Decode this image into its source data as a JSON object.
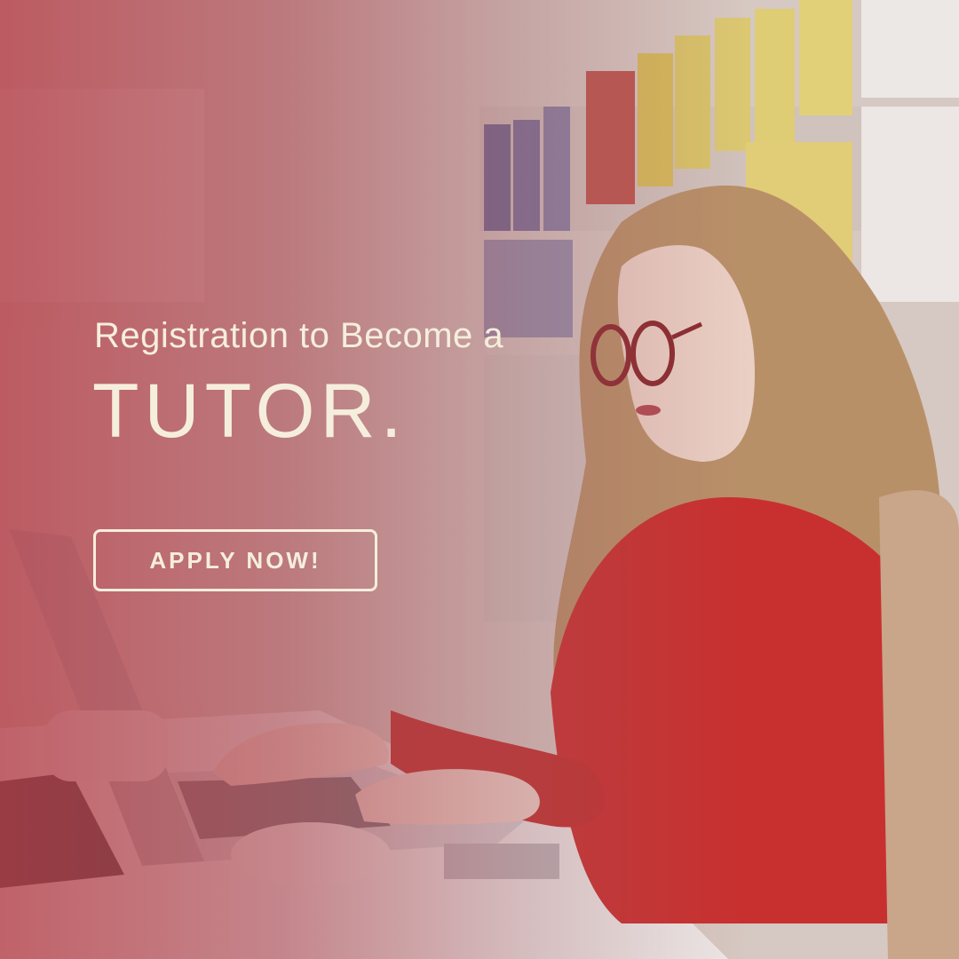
{
  "banner": {
    "subtitle": "Registration to Become a",
    "title": "TUTOR.",
    "cta_label": "APPLY NOW!"
  },
  "colors": {
    "text": "#f6eedd",
    "overlay": "#b43c46",
    "sweater": "#c8302f"
  },
  "photo": {
    "subject": "woman-with-glasses-using-laptop"
  }
}
